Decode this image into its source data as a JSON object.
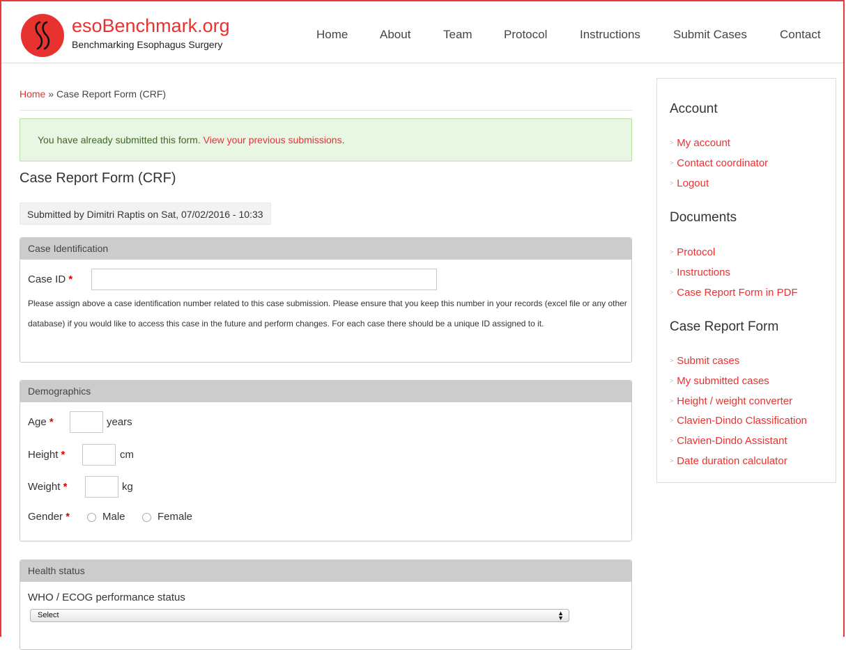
{
  "site": {
    "name": "esoBenchmark.org",
    "slogan": "Benchmarking Esophagus Surgery",
    "logo_icon": "double-s-logo-icon",
    "brand_color": "#e8322f"
  },
  "nav": {
    "items": [
      "Home",
      "About",
      "Team",
      "Protocol",
      "Instructions",
      "Submit Cases",
      "Contact"
    ]
  },
  "breadcrumb": {
    "home": "Home",
    "separator": "»",
    "current": "Case Report Form (CRF)"
  },
  "message": {
    "text": "You have already submitted this form.",
    "link": "View your previous submissions",
    "suffix": "."
  },
  "page": {
    "title": "Case Report Form (CRF)",
    "submitted": "Submitted by Dimitri Raptis on Sat, 07/02/2016 - 10:33"
  },
  "case_identification": {
    "legend": "Case Identification",
    "case_id_label": "Case ID",
    "required_mark": "*",
    "case_id_value": "",
    "help": "Please assign above a case identification number related to this case submission. Please ensure that you keep this number in your records (excel file or any other database) if you would like to access this case in the future and perform changes. For each case there should be a unique ID assigned to it."
  },
  "demographics": {
    "legend": "Demographics",
    "age_label": "Age",
    "age_unit": "years",
    "height_label": "Height",
    "height_unit": "cm",
    "weight_label": "Weight",
    "weight_unit": "kg",
    "gender_label": "Gender",
    "gender_options": [
      "Male",
      "Female"
    ],
    "required_mark": "*"
  },
  "health_status": {
    "legend": "Health status",
    "ecog_label": "WHO / ECOG performance status",
    "ecog_selected": "Select"
  },
  "sidebar": {
    "account_title": "Account",
    "account_links": [
      "My account",
      "Contact coordinator",
      "Logout"
    ],
    "documents_title": "Documents",
    "documents_links": [
      "Protocol",
      "Instructions",
      "Case Report Form in PDF"
    ],
    "crf_title": "Case Report Form",
    "crf_links": [
      "Submit cases",
      "My submitted cases",
      "Height / weight converter",
      "Clavien-Dindo Classification",
      "Clavien-Dindo Assistant",
      "Date duration calculator"
    ]
  }
}
